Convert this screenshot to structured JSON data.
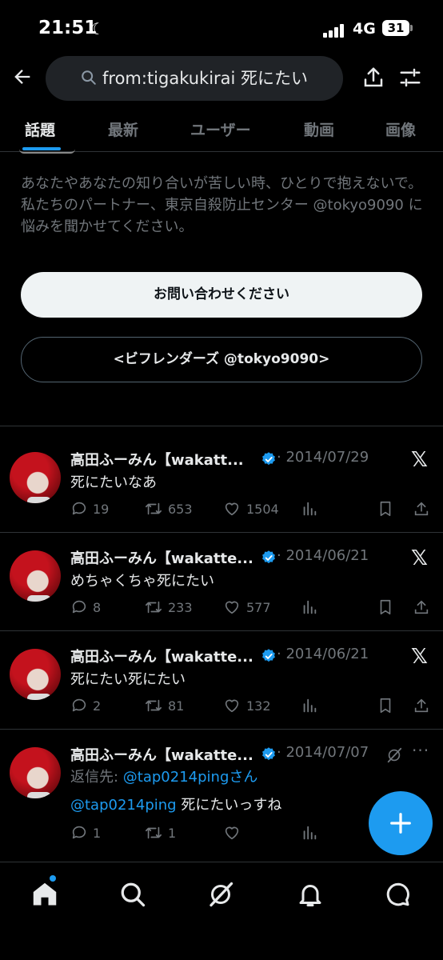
{
  "status_bar": {
    "time": "21:51",
    "network": "4G",
    "battery": "31"
  },
  "search": {
    "query": "from:tigakukirai 死にたい"
  },
  "tabs": [
    {
      "label": "話題",
      "active": true
    },
    {
      "label": "最新",
      "active": false
    },
    {
      "label": "ユーザー",
      "active": false
    },
    {
      "label": "動画",
      "active": false
    },
    {
      "label": "画像",
      "active": false
    }
  ],
  "info_card": {
    "message": "あなたやあなたの知り合いが苦しい時、ひとりで抱えないで。私たちのパートナー、東京自殺防止センター @tokyo9090 に悩みを聞かせてください。",
    "primary_button": "お問い合わせください",
    "secondary_button": "<ビフレンダーズ @tokyo9090>"
  },
  "tweets": [
    {
      "name": "高田ふーみん【wakatt...",
      "date": "· 2014/07/29",
      "text": "死にたいなあ",
      "replies": "19",
      "retweets": "653",
      "likes": "1504"
    },
    {
      "name": "高田ふーみん【wakatte...",
      "date": "· 2014/06/21",
      "text": "めちゃくちゃ死にたい",
      "replies": "8",
      "retweets": "233",
      "likes": "577"
    },
    {
      "name": "高田ふーみん【wakatte...",
      "date": "· 2014/06/21",
      "text": "死にたい死にたい",
      "replies": "2",
      "retweets": "81",
      "likes": "132"
    },
    {
      "name": "高田ふーみん【wakatte...",
      "date": "· 2014/07/07",
      "reply_prefix": "返信先: ",
      "reply_to": "@tap0214pingさん",
      "mention": "@tap0214ping",
      "text": " 死にたいっすね",
      "replies": "1",
      "retweets": "1",
      "likes": ""
    }
  ],
  "colors": {
    "accent": "#1d9bf0",
    "background": "#000000",
    "muted": "#71767b"
  },
  "icons": [
    "back-arrow-icon",
    "search-icon",
    "share-icon",
    "filter-icon",
    "verified-icon",
    "x-logo-icon",
    "grok-icon",
    "more-icon",
    "reply-icon",
    "retweet-icon",
    "like-icon",
    "views-icon",
    "bookmark-icon",
    "home-icon",
    "explore-icon",
    "notifications-icon",
    "messages-icon",
    "compose-icon"
  ]
}
